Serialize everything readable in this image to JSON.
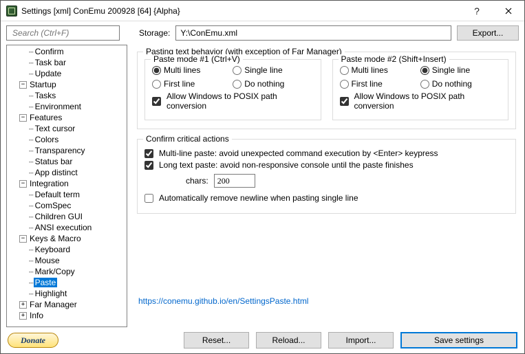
{
  "title": "Settings [xml] ConEmu 200928 [64] {Alpha}",
  "search": {
    "placeholder": "Search (Ctrl+F)"
  },
  "storage": {
    "label": "Storage:",
    "value": "Y:\\ConEmu.xml",
    "export": "Export..."
  },
  "tree": [
    {
      "depth": 2,
      "exp": "",
      "label": "Confirm"
    },
    {
      "depth": 2,
      "exp": "",
      "label": "Task bar"
    },
    {
      "depth": 2,
      "exp": "",
      "label": "Update"
    },
    {
      "depth": 1,
      "exp": "-",
      "label": "Startup"
    },
    {
      "depth": 2,
      "exp": "",
      "label": "Tasks"
    },
    {
      "depth": 2,
      "exp": "",
      "label": "Environment"
    },
    {
      "depth": 1,
      "exp": "-",
      "label": "Features"
    },
    {
      "depth": 2,
      "exp": "",
      "label": "Text cursor"
    },
    {
      "depth": 2,
      "exp": "",
      "label": "Colors"
    },
    {
      "depth": 2,
      "exp": "",
      "label": "Transparency"
    },
    {
      "depth": 2,
      "exp": "",
      "label": "Status bar"
    },
    {
      "depth": 2,
      "exp": "",
      "label": "App distinct"
    },
    {
      "depth": 1,
      "exp": "-",
      "label": "Integration"
    },
    {
      "depth": 2,
      "exp": "",
      "label": "Default term"
    },
    {
      "depth": 2,
      "exp": "",
      "label": "ComSpec"
    },
    {
      "depth": 2,
      "exp": "",
      "label": "Children GUI"
    },
    {
      "depth": 2,
      "exp": "",
      "label": "ANSI execution"
    },
    {
      "depth": 1,
      "exp": "-",
      "label": "Keys & Macro"
    },
    {
      "depth": 2,
      "exp": "",
      "label": "Keyboard"
    },
    {
      "depth": 2,
      "exp": "",
      "label": "Mouse"
    },
    {
      "depth": 2,
      "exp": "",
      "label": "Mark/Copy"
    },
    {
      "depth": 2,
      "exp": "",
      "label": "Paste",
      "selected": true
    },
    {
      "depth": 2,
      "exp": "",
      "label": "Highlight"
    },
    {
      "depth": 1,
      "exp": "+",
      "label": "Far Manager"
    },
    {
      "depth": 1,
      "exp": "+",
      "label": "Info"
    }
  ],
  "pasting": {
    "group_title": "Pasting text behavior (with exception of Far Manager)",
    "mode1": {
      "title": "Paste mode #1 (Ctrl+V)",
      "multi": "Multi lines",
      "single": "Single line",
      "first": "First line",
      "nothing": "Do nothing",
      "posix": "Allow Windows to POSIX path conversion",
      "selected": "multi",
      "posix_checked": true
    },
    "mode2": {
      "title": "Paste mode #2 (Shift+Insert)",
      "multi": "Multi lines",
      "single": "Single line",
      "first": "First line",
      "nothing": "Do nothing",
      "posix": "Allow Windows to POSIX path conversion",
      "selected": "single",
      "posix_checked": true
    }
  },
  "confirm": {
    "title": "Confirm critical actions",
    "multiline": "Multi-line paste: avoid unexpected command execution by <Enter> keypress",
    "multiline_checked": true,
    "longtext": "Long text paste: avoid non-responsive console until the paste finishes",
    "longtext_checked": true,
    "chars_label": "chars:",
    "chars_value": "200",
    "autoremove": "Automatically remove newline when pasting single line",
    "autoremove_checked": false
  },
  "help_link": "https://conemu.github.io/en/SettingsPaste.html",
  "footer": {
    "donate": "Donate",
    "reset": "Reset...",
    "reload": "Reload...",
    "import": "Import...",
    "save": "Save settings"
  }
}
